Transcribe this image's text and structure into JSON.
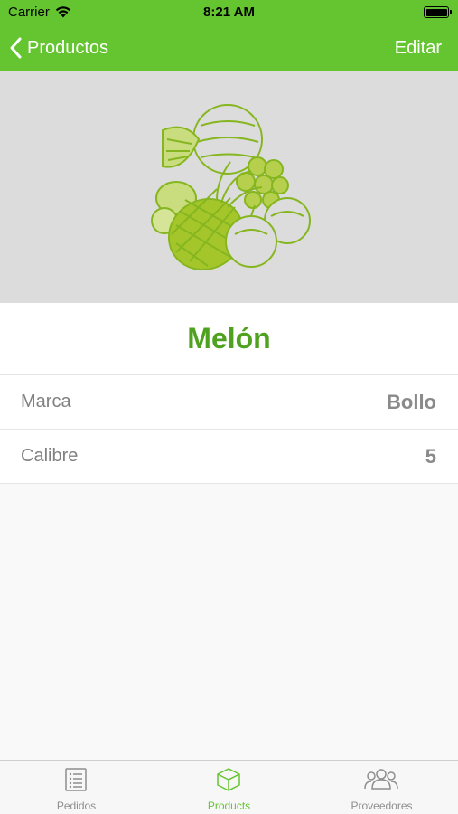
{
  "status_bar": {
    "carrier": "Carrier",
    "time": "8:21 AM"
  },
  "nav": {
    "back_label": "Productos",
    "edit_label": "Editar"
  },
  "product": {
    "name": "Melón",
    "fields": [
      {
        "label": "Marca",
        "value": "Bollo"
      },
      {
        "label": "Calibre",
        "value": "5"
      }
    ]
  },
  "tabs": [
    {
      "label": "Pedidos",
      "icon": "list-icon",
      "active": false
    },
    {
      "label": "Products",
      "icon": "box-icon",
      "active": true
    },
    {
      "label": "Proveedores",
      "icon": "people-icon",
      "active": false
    }
  ],
  "colors": {
    "accent": "#65c531",
    "title": "#4ea21f",
    "hero_bg": "#dcdcdc"
  }
}
